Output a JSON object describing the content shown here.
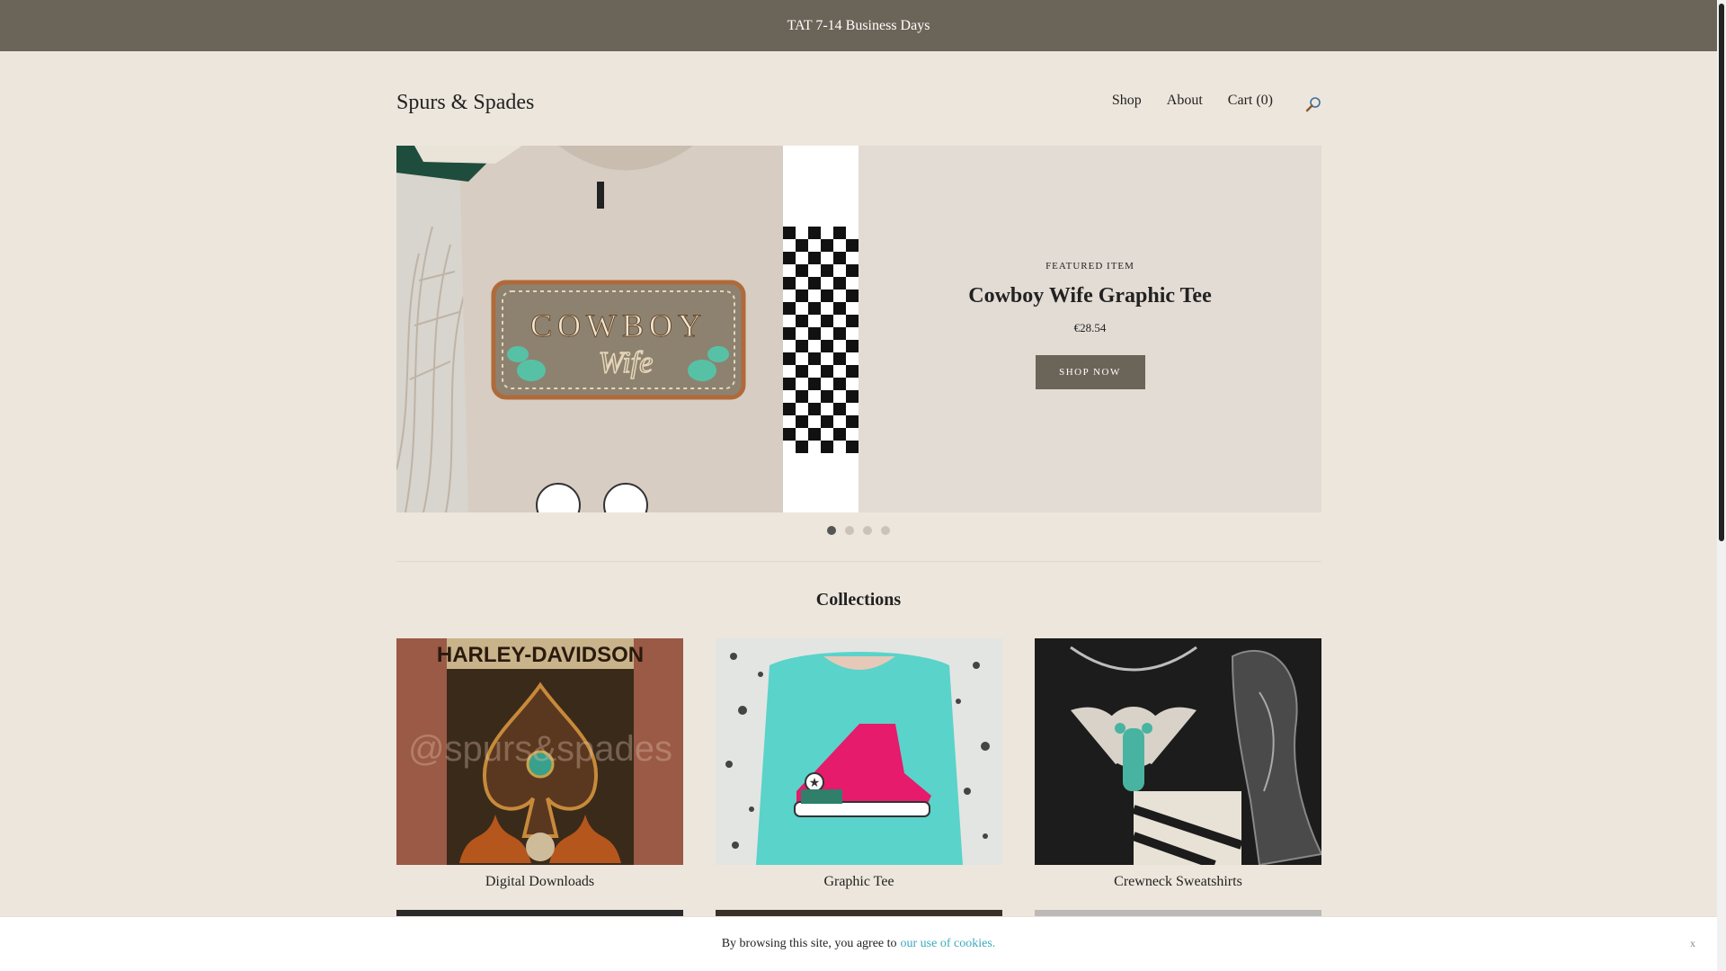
{
  "announcement": "TAT 7-14 Business Days",
  "header": {
    "logo": "Spurs & Spades",
    "nav": {
      "shop": "Shop",
      "about": "About",
      "cart": "Cart (0)"
    }
  },
  "hero": {
    "kicker": "FEATURED ITEM",
    "title": "Cowboy Wife Graphic Tee",
    "price": "€28.54",
    "button": "SHOP NOW",
    "shirt_text_top": "COWBOY",
    "shirt_text_bottom": "Wife",
    "slides": 4,
    "active_slide": 1
  },
  "collections": {
    "title": "Collections",
    "items": [
      {
        "label": "Digital Downloads",
        "art_text": "HARLEY-DAVIDSON",
        "watermark": "@spurs&spades"
      },
      {
        "label": "Graphic Tee"
      },
      {
        "label": "Crewneck Sweatshirts"
      }
    ]
  },
  "cookie": {
    "text": "By browsing this site, you agree to",
    "link": "our use of cookies.",
    "close": "x"
  },
  "colors": {
    "background": "#ede6dc",
    "accent": "#6b6458",
    "hero_panel": "#e2dcd4",
    "link": "#3aa9bf"
  }
}
